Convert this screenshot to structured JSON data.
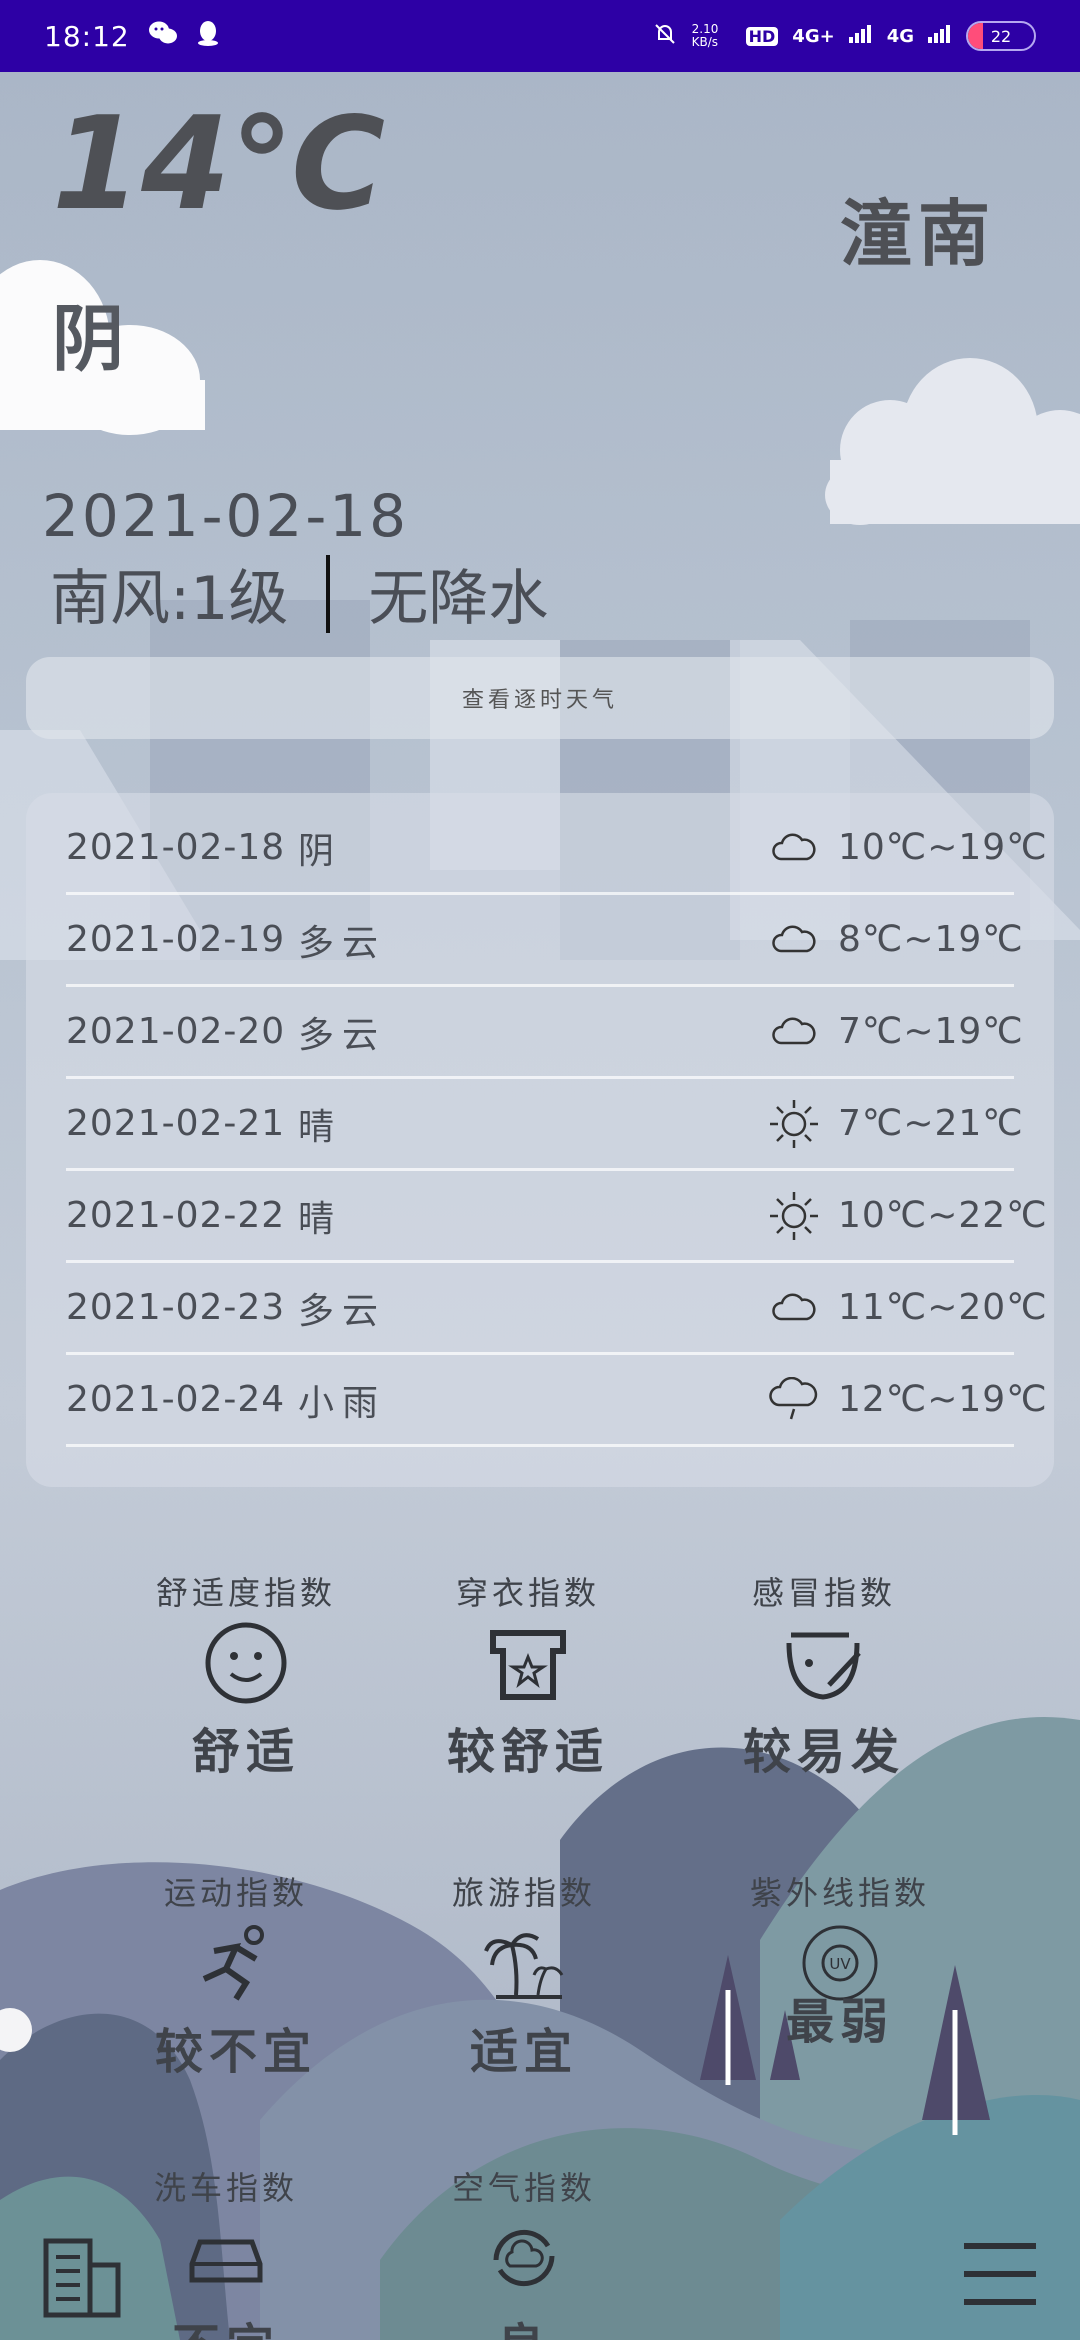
{
  "status_bar": {
    "time": "18:12",
    "net_speed": "2.10 KB/s",
    "hd": "HD",
    "net1": "4G+",
    "net2": "4G",
    "battery": "22"
  },
  "current": {
    "temperature": "14℃",
    "condition": "阴",
    "city": "潼南",
    "date": "2021-02-18",
    "wind": "南风:1级",
    "precipitation": "无降水"
  },
  "hourly_button_label": "查看逐时天气",
  "forecast": [
    {
      "date": "2021-02-18",
      "condition": "阴",
      "icon": "cloud-icon",
      "temp": "10℃~19℃"
    },
    {
      "date": "2021-02-19",
      "condition": "多云",
      "icon": "cloud-icon",
      "temp": "8℃~19℃"
    },
    {
      "date": "2021-02-20",
      "condition": "多云",
      "icon": "cloud-icon",
      "temp": "7℃~19℃"
    },
    {
      "date": "2021-02-21",
      "condition": "晴",
      "icon": "sun-icon",
      "temp": "7℃~21℃"
    },
    {
      "date": "2021-02-22",
      "condition": "晴",
      "icon": "sun-icon",
      "temp": "10℃~22℃"
    },
    {
      "date": "2021-02-23",
      "condition": "多云",
      "icon": "cloud-icon",
      "temp": "11℃~20℃"
    },
    {
      "date": "2021-02-24",
      "condition": "小雨",
      "icon": "rain-icon",
      "temp": "12℃~19℃"
    }
  ],
  "indices": [
    {
      "label": "舒适度指数",
      "value": "舒适",
      "icon": "smile-icon"
    },
    {
      "label": "穿衣指数",
      "value": "较舒适",
      "icon": "shirt-icon"
    },
    {
      "label": "感冒指数",
      "value": "较易发",
      "icon": "cold-icon"
    },
    {
      "label": "运动指数",
      "value": "较不宜",
      "icon": "run-icon"
    },
    {
      "label": "旅游指数",
      "value": "适宜",
      "icon": "palm-icon"
    },
    {
      "label": "紫外线指数",
      "value": "最弱",
      "icon": "uv-icon"
    },
    {
      "label": "洗车指数",
      "value": "不宜",
      "icon": "car-icon"
    },
    {
      "label": "空气指数",
      "value": "良",
      "icon": "air-icon"
    }
  ],
  "uv_badge": "UV",
  "colors": {
    "status_bar": "#2d00a5",
    "text": "#4a4e56"
  }
}
